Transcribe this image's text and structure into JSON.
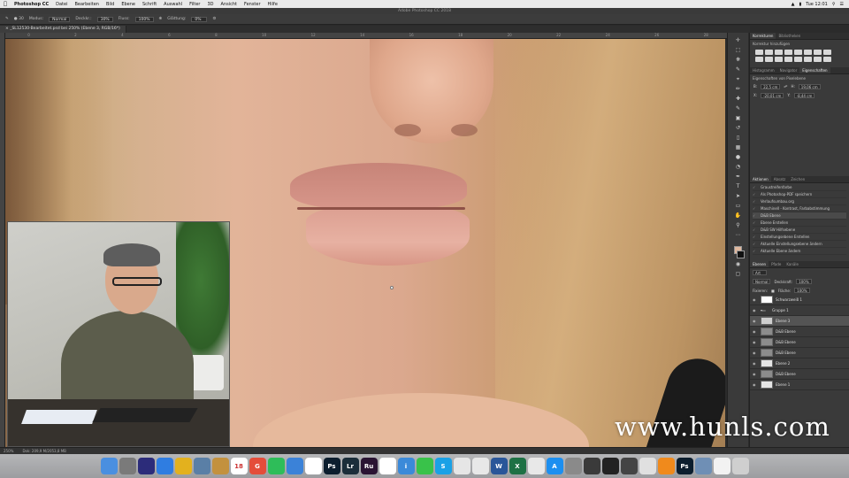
{
  "menubar": {
    "app": "Photoshop CC",
    "items": [
      "Datei",
      "Bearbeiten",
      "Bild",
      "Ebene",
      "Schrift",
      "Auswahl",
      "Filter",
      "3D",
      "Ansicht",
      "Fenster",
      "Hilfe"
    ],
    "clock": "Tue 12:01"
  },
  "window_title": "Adobe Photoshop CC 2018",
  "options_bar": {
    "mode_label": "Modus:",
    "mode_value": "Normal",
    "opacity_label": "Deckkr.:",
    "opacity_value": "30%",
    "flow_label": "Fluss:",
    "flow_value": "100%",
    "smooth_label": "Glättung:",
    "smooth_value": "0%"
  },
  "document_tab": "_SL12530-Bearbeitet.psd bei 250% (Ebene 3, RGB/16*)",
  "ruler_ticks": [
    "0",
    "2",
    "4",
    "6",
    "8",
    "10",
    "12",
    "14",
    "16",
    "18",
    "20",
    "22",
    "24",
    "26",
    "28"
  ],
  "status_bar": {
    "zoom": "250%",
    "doc": "Dok: 209,9 M/2053,8 MB"
  },
  "panels": {
    "top_tabs": [
      "Korrekturen",
      "Bibliotheken"
    ],
    "adjust_title": "Korrektur hinzufügen",
    "mid_tabs": [
      "Histogramm",
      "Navigator",
      "Eigenschaften"
    ],
    "props_title": "Eigenschaften von Pixelebene",
    "props": {
      "w_label": "B:",
      "w_value": "22,5 cm",
      "h_label": "H:",
      "h_value": "19,06 cm",
      "x_label": "X:",
      "x_value": "-20,01 cm",
      "y_label": "Y:",
      "y_value": "-8,44 cm"
    },
    "history_tabs": [
      "Aktionen",
      "Absatz",
      "Zeichen"
    ],
    "history": [
      {
        "label": "Graustreifenfarbe"
      },
      {
        "label": "Als Photoshop-PDF speichern"
      },
      {
        "label": "Verlaufsumbau.org"
      },
      {
        "label": "Maschinell - Kontrast, Farbabstimmung"
      },
      {
        "label": "D&B Ebene"
      },
      {
        "label": "Ebene Erstellen"
      },
      {
        "label": "D&B SW Hilfsebene"
      },
      {
        "label": "Einstellungsebene Erstellen"
      },
      {
        "label": "Aktuelle Einstellungsebene ändern"
      },
      {
        "label": "Aktuelle Ebene ändern"
      }
    ],
    "layers_tabs": [
      "Ebenen",
      "Pfade",
      "Kanäle"
    ],
    "layers_kind": "Art",
    "blend_mode": "Normal",
    "opacity_label": "Deckkraft:",
    "opacity_value": "100%",
    "fixieren_label": "Fixieren:",
    "fill_label": "Fläche:",
    "fill_value": "100%",
    "layers": [
      {
        "name": "Schwarzweiß 1",
        "type": "adjust"
      },
      {
        "name": "Gruppe 1",
        "type": "group"
      },
      {
        "name": "Ebene 3",
        "type": "pixel"
      },
      {
        "name": "D&B Ebene",
        "type": "pixel"
      },
      {
        "name": "D&B Ebene",
        "type": "pixel"
      },
      {
        "name": "D&B Ebene",
        "type": "pixel"
      },
      {
        "name": "Ebene 2",
        "type": "pixel"
      },
      {
        "name": "D&B Ebene",
        "type": "pixel"
      },
      {
        "name": "Ebene 1",
        "type": "pixel"
      }
    ]
  },
  "watermark": "www.hunls.com",
  "dock": [
    {
      "icon": "finder-icon",
      "label": "",
      "bg": "#4a8fe0"
    },
    {
      "icon": "launchpad-icon",
      "label": "",
      "bg": "#7a7a7a"
    },
    {
      "icon": "siri-icon",
      "label": "",
      "bg": "#2c2c7a"
    },
    {
      "icon": "safari-icon",
      "label": "",
      "bg": "#2f7de1"
    },
    {
      "icon": "chrome-icon",
      "label": "",
      "bg": "#e3b11e"
    },
    {
      "icon": "preview-icon",
      "label": "",
      "bg": "#5a7fa6"
    },
    {
      "icon": "notes-icon",
      "label": "",
      "bg": "#c3913e"
    },
    {
      "icon": "calendar-icon",
      "label": "18",
      "bg": "#ffffff"
    },
    {
      "icon": "google-icon",
      "label": "G",
      "bg": "#e44d3a"
    },
    {
      "icon": "spotify-icon",
      "label": "",
      "bg": "#2ebd59"
    },
    {
      "icon": "keynote-icon",
      "label": "",
      "bg": "#3b82d8"
    },
    {
      "icon": "textedit-icon",
      "label": "",
      "bg": "#ffffff"
    },
    {
      "icon": "photoshop-icon",
      "label": "Ps",
      "bg": "#0c1e2e"
    },
    {
      "icon": "lightroom-icon",
      "label": "Lr",
      "bg": "#1b2e3a"
    },
    {
      "icon": "rush-icon",
      "label": "Ru",
      "bg": "#2a1433"
    },
    {
      "icon": "reminders-icon",
      "label": "",
      "bg": "#ffffff"
    },
    {
      "icon": "info-icon",
      "label": "i",
      "bg": "#3b8ad9"
    },
    {
      "icon": "messages-icon",
      "label": "",
      "bg": "#39c24a"
    },
    {
      "icon": "skype-icon",
      "label": "S",
      "bg": "#1aa1e6"
    },
    {
      "icon": "appstore-icon",
      "label": "",
      "bg": "#e6e6e6"
    },
    {
      "icon": "facetime-icon",
      "label": "",
      "bg": "#e8e8e8"
    },
    {
      "icon": "word-icon",
      "label": "W",
      "bg": "#2a5699"
    },
    {
      "icon": "excel-icon",
      "label": "X",
      "bg": "#1e7145"
    },
    {
      "icon": "numbers-icon",
      "label": "",
      "bg": "#e8e8e8"
    },
    {
      "icon": "appstore2-icon",
      "label": "A",
      "bg": "#1c8ff0"
    },
    {
      "icon": "prefs-icon",
      "label": "",
      "bg": "#8a8a8a"
    },
    {
      "icon": "camera-icon",
      "label": "",
      "bg": "#3a3a3a"
    },
    {
      "icon": "globe-icon",
      "label": "",
      "bg": "#222222"
    },
    {
      "icon": "photobooth-icon",
      "label": "",
      "bg": "#444444"
    },
    {
      "icon": "photos-icon",
      "label": "",
      "bg": "#e0e0e0"
    },
    {
      "icon": "vlc-icon",
      "label": "",
      "bg": "#f08a1c"
    },
    {
      "icon": "photoshop2-icon",
      "label": "Ps",
      "bg": "#0c1e2e"
    },
    {
      "icon": "image-icon",
      "label": "",
      "bg": "#6f8fb5"
    },
    {
      "icon": "document-icon",
      "label": "",
      "bg": "#f2f2f2"
    },
    {
      "icon": "trash-icon",
      "label": "",
      "bg": "#cfcfcf"
    }
  ]
}
